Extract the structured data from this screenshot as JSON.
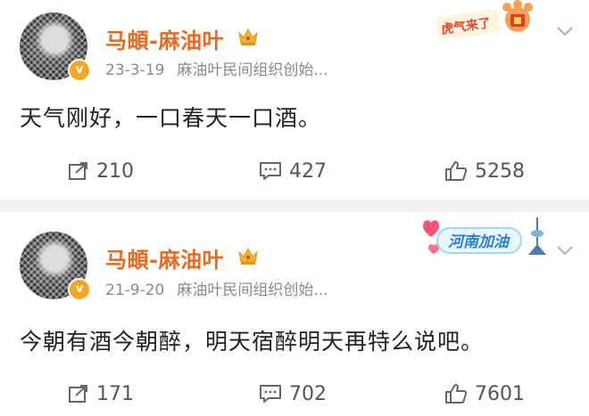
{
  "posts": [
    {
      "author": "马頔-麻油叶",
      "date": "23-3-19",
      "source": "麻油叶民间组织创始...",
      "content": "天气刚好，一口春天一口酒。",
      "repost_count": "210",
      "comment_count": "427",
      "like_count": "5258",
      "sticker_text": "虎气来了",
      "verified_badge": "v"
    },
    {
      "author": "马頔-麻油叶",
      "date": "21-9-20",
      "source": "麻油叶民间组织创始...",
      "content": "今朝有酒今朝醉，明天宿醉明天再特么说吧。",
      "repost_count": "171",
      "comment_count": "702",
      "like_count": "7601",
      "sticker_text": "河南加油",
      "verified_badge": "v"
    }
  ],
  "colors": {
    "author_name": "#e86b22",
    "meta_text": "#8a8a8a",
    "action_text": "#555555",
    "divider": "#f1f1f1",
    "verified_badge": "#f5a623"
  },
  "icons": [
    "share-icon",
    "comment-icon",
    "like-icon",
    "chevron-down-icon",
    "crown-icon"
  ]
}
